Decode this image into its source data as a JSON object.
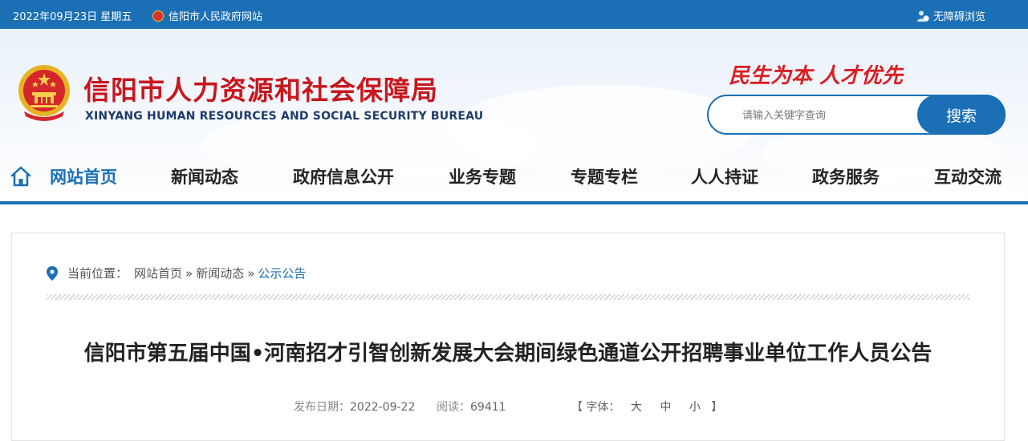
{
  "topbar": {
    "date": "2022年09月23日 星期五",
    "gov_site": "信阳市人民政府网站",
    "accessibility": "无障碍浏览",
    "bg_color": "#1a6fb5"
  },
  "header": {
    "title": "信阳市人力资源和社会保障局",
    "subtitle": "XINYANG HUMAN RESOURCES AND SOCIAL SECURITY BUREAU",
    "slogan": "民生为本 人才优先",
    "title_color": "#c8161d"
  },
  "search": {
    "placeholder": "请输入关键字查询",
    "button_label": "搜索"
  },
  "nav": {
    "items": [
      {
        "label": "网站首页",
        "active": true
      },
      {
        "label": "新闻动态"
      },
      {
        "label": "政府信息公开"
      },
      {
        "label": "业务专题"
      },
      {
        "label": "专题专栏"
      },
      {
        "label": "人人持证"
      },
      {
        "label": "政务服务"
      },
      {
        "label": "互动交流"
      }
    ],
    "accent": "#1a6fb5"
  },
  "breadcrumb": {
    "prefix": "当前位置：",
    "items": [
      "网站首页",
      "新闻动态",
      "公示公告"
    ],
    "separator": "»"
  },
  "article": {
    "title": "信阳市第五届中国•河南招才引智创新发展大会期间绿色通道公开招聘事业单位工作人员公告",
    "publish_label": "发布日期：",
    "publish_date": "2022-09-22",
    "read_label": "阅读：",
    "read_count": "69411",
    "font_open": "【 字体：",
    "font_sizes": [
      "大",
      "中",
      "小"
    ],
    "font_close": "】"
  },
  "icons": {
    "home": "home-icon",
    "location": "location-pin-icon",
    "accessibility": "user-accessibility-icon",
    "emblem": "national-emblem-icon"
  }
}
